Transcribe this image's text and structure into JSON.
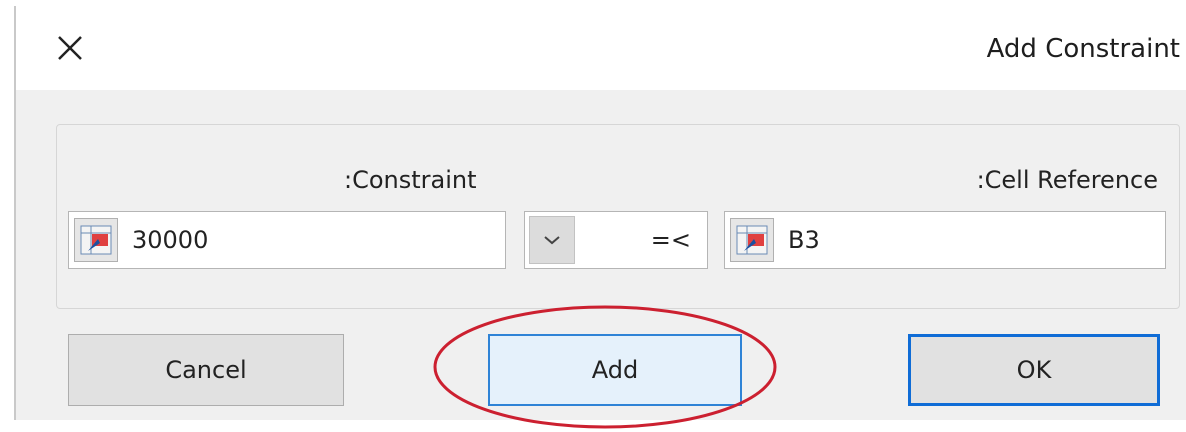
{
  "window": {
    "title": "Add Constraint",
    "close_icon": "close-icon"
  },
  "form": {
    "constraint_label": ":Constraint",
    "cell_reference_label": ":Cell Reference",
    "constraint_value": "30000",
    "operator_value": "=<",
    "cell_reference_value": "B3",
    "range_picker_icon": "range-select-icon",
    "dropdown_icon": "chevron-down-icon"
  },
  "buttons": {
    "cancel": "Cancel",
    "add": "Add",
    "ok": "OK"
  },
  "annotation": {
    "highlight_color": "#cc2030"
  },
  "colors": {
    "accent": "#0f6cd6",
    "add_button_border": "#2f83d6",
    "add_button_fill": "#e5f1fb"
  }
}
